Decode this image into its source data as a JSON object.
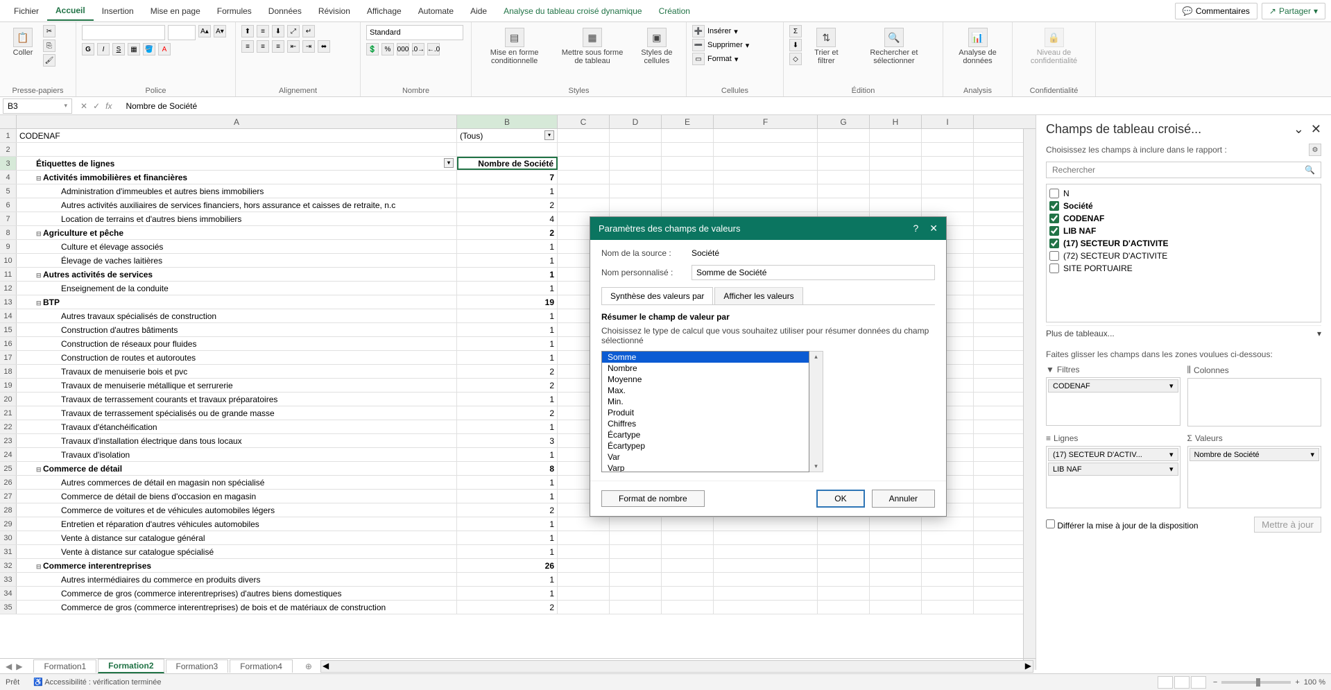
{
  "menubar": {
    "tabs": [
      "Fichier",
      "Accueil",
      "Insertion",
      "Mise en page",
      "Formules",
      "Données",
      "Révision",
      "Affichage",
      "Automate",
      "Aide",
      "Analyse du tableau croisé dynamique",
      "Création"
    ],
    "active": "Accueil",
    "comments": "Commentaires",
    "share": "Partager"
  },
  "ribbon_groups": [
    "Presse-papiers",
    "Police",
    "Alignement",
    "Nombre",
    "Styles",
    "Cellules",
    "Édition",
    "Analysis",
    "Confidentialité"
  ],
  "ribbon": {
    "paste": "Coller",
    "number_format": "Standard",
    "cond_format": "Mise en forme conditionnelle",
    "table_format": "Mettre sous forme de tableau",
    "cell_styles": "Styles de cellules",
    "insert": "Insérer",
    "delete": "Supprimer",
    "format": "Format",
    "sort_filter": "Trier et filtrer",
    "find_select": "Rechercher et sélectionner",
    "analyze": "Analyse de données",
    "confidentiality": "Niveau de confidentialité"
  },
  "namebox": "B3",
  "formula": "Nombre de Société",
  "columns": [
    "A",
    "B",
    "C",
    "D",
    "E",
    "F",
    "G",
    "H",
    "I"
  ],
  "rows": [
    {
      "n": 1,
      "a": "CODENAF",
      "b": "(Tous)",
      "filter": true
    },
    {
      "n": 2,
      "a": "",
      "b": ""
    },
    {
      "n": 3,
      "a": "Étiquettes de lignes",
      "b": "Nombre de Société",
      "bold": true,
      "dd": true,
      "sel": true
    },
    {
      "n": 4,
      "a": "Activités immobilières et financières",
      "b": "7",
      "bold": true,
      "exp": true
    },
    {
      "n": 5,
      "a": "Administration d'immeubles et autres biens immobiliers",
      "b": "1",
      "ind": 2
    },
    {
      "n": 6,
      "a": "Autres activités auxiliaires de services financiers, hors assurance et caisses de retraite, n.c",
      "b": "2",
      "ind": 2
    },
    {
      "n": 7,
      "a": "Location de terrains et d'autres biens immobiliers",
      "b": "4",
      "ind": 2
    },
    {
      "n": 8,
      "a": "Agriculture et pêche",
      "b": "2",
      "bold": true,
      "exp": true
    },
    {
      "n": 9,
      "a": "Culture et élevage associés",
      "b": "1",
      "ind": 2
    },
    {
      "n": 10,
      "a": "Élevage de vaches laitières",
      "b": "1",
      "ind": 2
    },
    {
      "n": 11,
      "a": "Autres activités de services",
      "b": "1",
      "bold": true,
      "exp": true
    },
    {
      "n": 12,
      "a": "Enseignement de la conduite",
      "b": "1",
      "ind": 2
    },
    {
      "n": 13,
      "a": "BTP",
      "b": "19",
      "bold": true,
      "exp": true
    },
    {
      "n": 14,
      "a": "Autres travaux spécialisés de construction",
      "b": "1",
      "ind": 2
    },
    {
      "n": 15,
      "a": "Construction d'autres bâtiments",
      "b": "1",
      "ind": 2
    },
    {
      "n": 16,
      "a": "Construction de réseaux pour fluides",
      "b": "1",
      "ind": 2
    },
    {
      "n": 17,
      "a": "Construction de routes et autoroutes",
      "b": "1",
      "ind": 2
    },
    {
      "n": 18,
      "a": "Travaux de menuiserie bois et pvc",
      "b": "2",
      "ind": 2
    },
    {
      "n": 19,
      "a": "Travaux de menuiserie métallique et serrurerie",
      "b": "2",
      "ind": 2
    },
    {
      "n": 20,
      "a": "Travaux de terrassement courants et travaux préparatoires",
      "b": "1",
      "ind": 2
    },
    {
      "n": 21,
      "a": "Travaux de terrassement spécialisés ou de grande masse",
      "b": "2",
      "ind": 2
    },
    {
      "n": 22,
      "a": "Travaux d'étanchéification",
      "b": "1",
      "ind": 2
    },
    {
      "n": 23,
      "a": "Travaux d'installation électrique dans tous locaux",
      "b": "3",
      "ind": 2
    },
    {
      "n": 24,
      "a": "Travaux d'isolation",
      "b": "1",
      "ind": 2
    },
    {
      "n": 25,
      "a": "Commerce de détail",
      "b": "8",
      "bold": true,
      "exp": true
    },
    {
      "n": 26,
      "a": "Autres commerces de détail en magasin non spécialisé",
      "b": "1",
      "ind": 2
    },
    {
      "n": 27,
      "a": "Commerce de détail de biens d'occasion en magasin",
      "b": "1",
      "ind": 2
    },
    {
      "n": 28,
      "a": "Commerce de voitures et de véhicules automobiles légers",
      "b": "2",
      "ind": 2
    },
    {
      "n": 29,
      "a": "Entretien et réparation d'autres véhicules automobiles",
      "b": "1",
      "ind": 2
    },
    {
      "n": 30,
      "a": "Vente à distance sur catalogue général",
      "b": "1",
      "ind": 2
    },
    {
      "n": 31,
      "a": "Vente à distance sur catalogue spécialisé",
      "b": "1",
      "ind": 2
    },
    {
      "n": 32,
      "a": "Commerce interentreprises",
      "b": "26",
      "bold": true,
      "exp": true
    },
    {
      "n": 33,
      "a": "Autres intermédiaires du commerce en produits divers",
      "b": "1",
      "ind": 2
    },
    {
      "n": 34,
      "a": "Commerce de gros (commerce interentreprises) d'autres biens domestiques",
      "b": "1",
      "ind": 2
    },
    {
      "n": 35,
      "a": "Commerce de gros (commerce interentreprises) de bois et de matériaux de construction",
      "b": "2",
      "ind": 2
    }
  ],
  "sheets": [
    "Formation1",
    "Formation2",
    "Formation3",
    "Formation4"
  ],
  "active_sheet": "Formation2",
  "dialog": {
    "title": "Paramètres des champs de valeurs",
    "source_label": "Nom de la source :",
    "source_value": "Société",
    "custom_label": "Nom personnalisé :",
    "custom_value": "Somme de Société",
    "tab1": "Synthèse des valeurs par",
    "tab2": "Afficher les valeurs",
    "section": "Résumer le champ de valeur par",
    "hint": "Choisissez le type de calcul que vous souhaitez utiliser pour résumer données du champ sélectionné",
    "options": [
      "Somme",
      "Nombre",
      "Moyenne",
      "Max.",
      "Min.",
      "Produit",
      "Chiffres",
      "Écartype",
      "Écartypep",
      "Var",
      "Varp"
    ],
    "selected": "Somme",
    "format_btn": "Format de nombre",
    "ok": "OK",
    "cancel": "Annuler"
  },
  "taskpane": {
    "title": "Champs de tableau croisé...",
    "subtitle": "Choisissez les champs à inclure dans le rapport :",
    "search_ph": "Rechercher",
    "fields": [
      {
        "name": "N",
        "checked": false
      },
      {
        "name": "Société",
        "checked": true
      },
      {
        "name": "CODENAF",
        "checked": true
      },
      {
        "name": "LIB NAF",
        "checked": true
      },
      {
        "name": "(17) SECTEUR D'ACTIVITE",
        "checked": true
      },
      {
        "name": "(72) SECTEUR D'ACTIVITE",
        "checked": false
      },
      {
        "name": "SITE PORTUAIRE",
        "checked": false
      }
    ],
    "more": "Plus de tableaux...",
    "drag_hint": "Faites glisser les champs dans les zones voulues ci-dessous:",
    "filters_title": "Filtres",
    "columns_title": "Colonnes",
    "rows_title": "Lignes",
    "values_title": "Valeurs",
    "filter_chips": [
      "CODENAF"
    ],
    "row_chips": [
      "(17) SECTEUR D'ACTIV...",
      "LIB NAF"
    ],
    "value_chips": [
      "Nombre de Société"
    ],
    "defer": "Différer la mise à jour de la disposition",
    "update": "Mettre à jour"
  },
  "status": {
    "ready": "Prêt",
    "access": "Accessibilité : vérification terminée",
    "zoom": "100 %"
  }
}
